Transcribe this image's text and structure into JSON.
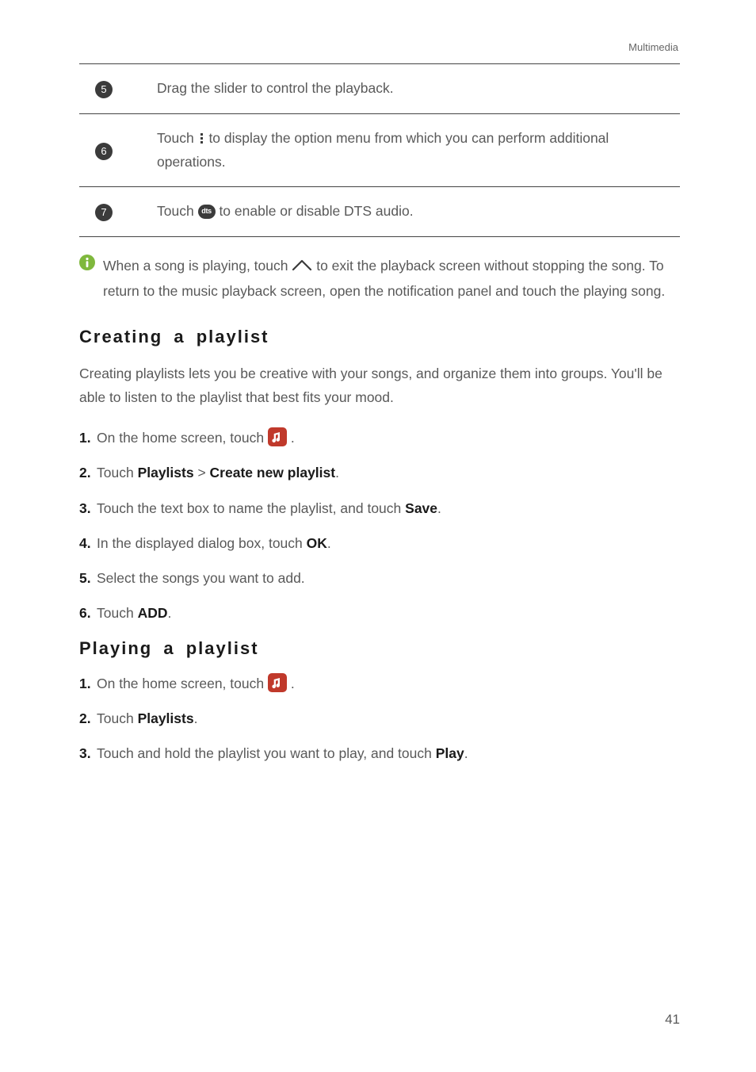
{
  "header": {
    "section_label": "Multimedia"
  },
  "table": {
    "rows": [
      {
        "num": "5",
        "text": "Drag the slider to control the playback."
      },
      {
        "num": "6",
        "text_before": "Touch ",
        "text_after": " to display the option menu from which you can perform additional operations."
      },
      {
        "num": "7",
        "text_before": "Touch ",
        "dts": "dts",
        "text_after": " to enable or disable DTS audio."
      }
    ]
  },
  "info": {
    "text_before": "When a song is playing, touch ",
    "text_after": "to exit the playback screen without stopping the song. To return to the music playback screen, open the notification panel and touch the playing song."
  },
  "sections": {
    "creating": {
      "title": "Creating a playlist",
      "lead": "Creating playlists lets you be creative with your songs, and organize them into groups. You'll be able to listen to the playlist that best fits your mood.",
      "steps": {
        "s1_a": "On the home screen, touch ",
        "s1_b": ".",
        "s2_a": "Touch ",
        "s2_b": "Playlists",
        "s2_c": " > ",
        "s2_d": "Create new playlist",
        "s2_e": ".",
        "s3_a": "Touch the text box to name the playlist, and touch ",
        "s3_b": "Save",
        "s3_c": ".",
        "s4_a": "In the displayed dialog box, touch ",
        "s4_b": "OK",
        "s4_c": ".",
        "s5": "Select the songs you want to add.",
        "s6_a": "Touch ",
        "s6_b": "ADD",
        "s6_c": "."
      }
    },
    "playing": {
      "title": "Playing a playlist",
      "steps": {
        "s1_a": "On the home screen, touch ",
        "s1_b": ".",
        "s2_a": "Touch ",
        "s2_b": "Playlists",
        "s2_c": ".",
        "s3_a": "Touch and hold the playlist you want to play, and touch ",
        "s3_b": "Play",
        "s3_c": "."
      }
    }
  },
  "step_numbers": {
    "n1": "1.",
    "n2": "2.",
    "n3": "3.",
    "n4": "4.",
    "n5": "5.",
    "n6": "6."
  },
  "page_number": "41"
}
